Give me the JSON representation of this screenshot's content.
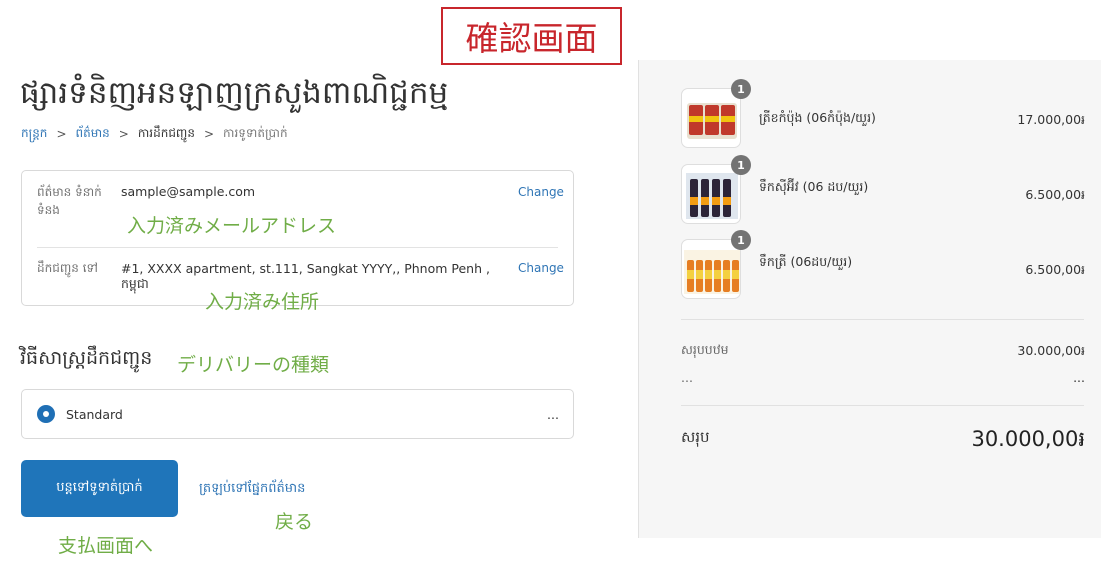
{
  "annotations": {
    "screen_title": "確認画面",
    "entered_email": "入力済みメールアドレス",
    "entered_address": "入力済み住所",
    "delivery_type": "デリバリーの種類",
    "to_payment": "支払画面へ",
    "back": "戻る"
  },
  "store": {
    "title": "ផ្សារទំនិញអនឡាញក្រសួងពាណិជ្ជកម្ម"
  },
  "breadcrumb": [
    "កន្ត្រក",
    "ព័ត៌មាន",
    "ការដឹកជញ្ជូន",
    "ការទូទាត់ប្រាក់"
  ],
  "review": {
    "contact_label": "ព័ត៌មាន ទំនាក់ទំនង",
    "contact_value": "sample@sample.com",
    "shipto_label": "ដឹកជញ្ជូន ទៅ",
    "shipto_value_line1": "#1, XXXX apartment, st.111, Sangkat YYYY,, Phnom Penh ,",
    "shipto_value_line2": "កម្ពុជា",
    "change_label": "Change"
  },
  "shipping": {
    "heading": "វិធីសាស្ត្រដឹកជញ្ជូន",
    "option": "Standard",
    "option_price": "..."
  },
  "actions": {
    "continue": "បន្តទៅទូទាត់ប្រាក់",
    "return": "ត្រឡប់ទៅផ្នែកព័ត៌មាន"
  },
  "order": {
    "items": [
      {
        "name": "ត្រីខកំប៉ុង (06កំប៉ុង/យួរ)",
        "price": "17.000,00៛",
        "qty": "1",
        "icon": "canned-fish-image"
      },
      {
        "name": "ទឹកស៊ីអ៊ីវ (06 ដប/យួរ)",
        "price": "6.500,00៛",
        "qty": "1",
        "icon": "soy-sauce-bottles-image"
      },
      {
        "name": "ទឹកត្រី (06ដប/យួរ)",
        "price": "6.500,00៛",
        "qty": "1",
        "icon": "fish-sauce-bottles-image"
      }
    ],
    "subtotal_label": "សរុបបឋម",
    "subtotal_value": "30.000,00៛",
    "shipping_label": "...",
    "shipping_value": "...",
    "total_label": "សរុប",
    "total_value": "30.000,00៛"
  },
  "colors": {
    "accent": "#1f75ba",
    "link": "#2f75b5",
    "annotation_green": "#70ad47",
    "annotation_red": "#c8262c"
  }
}
